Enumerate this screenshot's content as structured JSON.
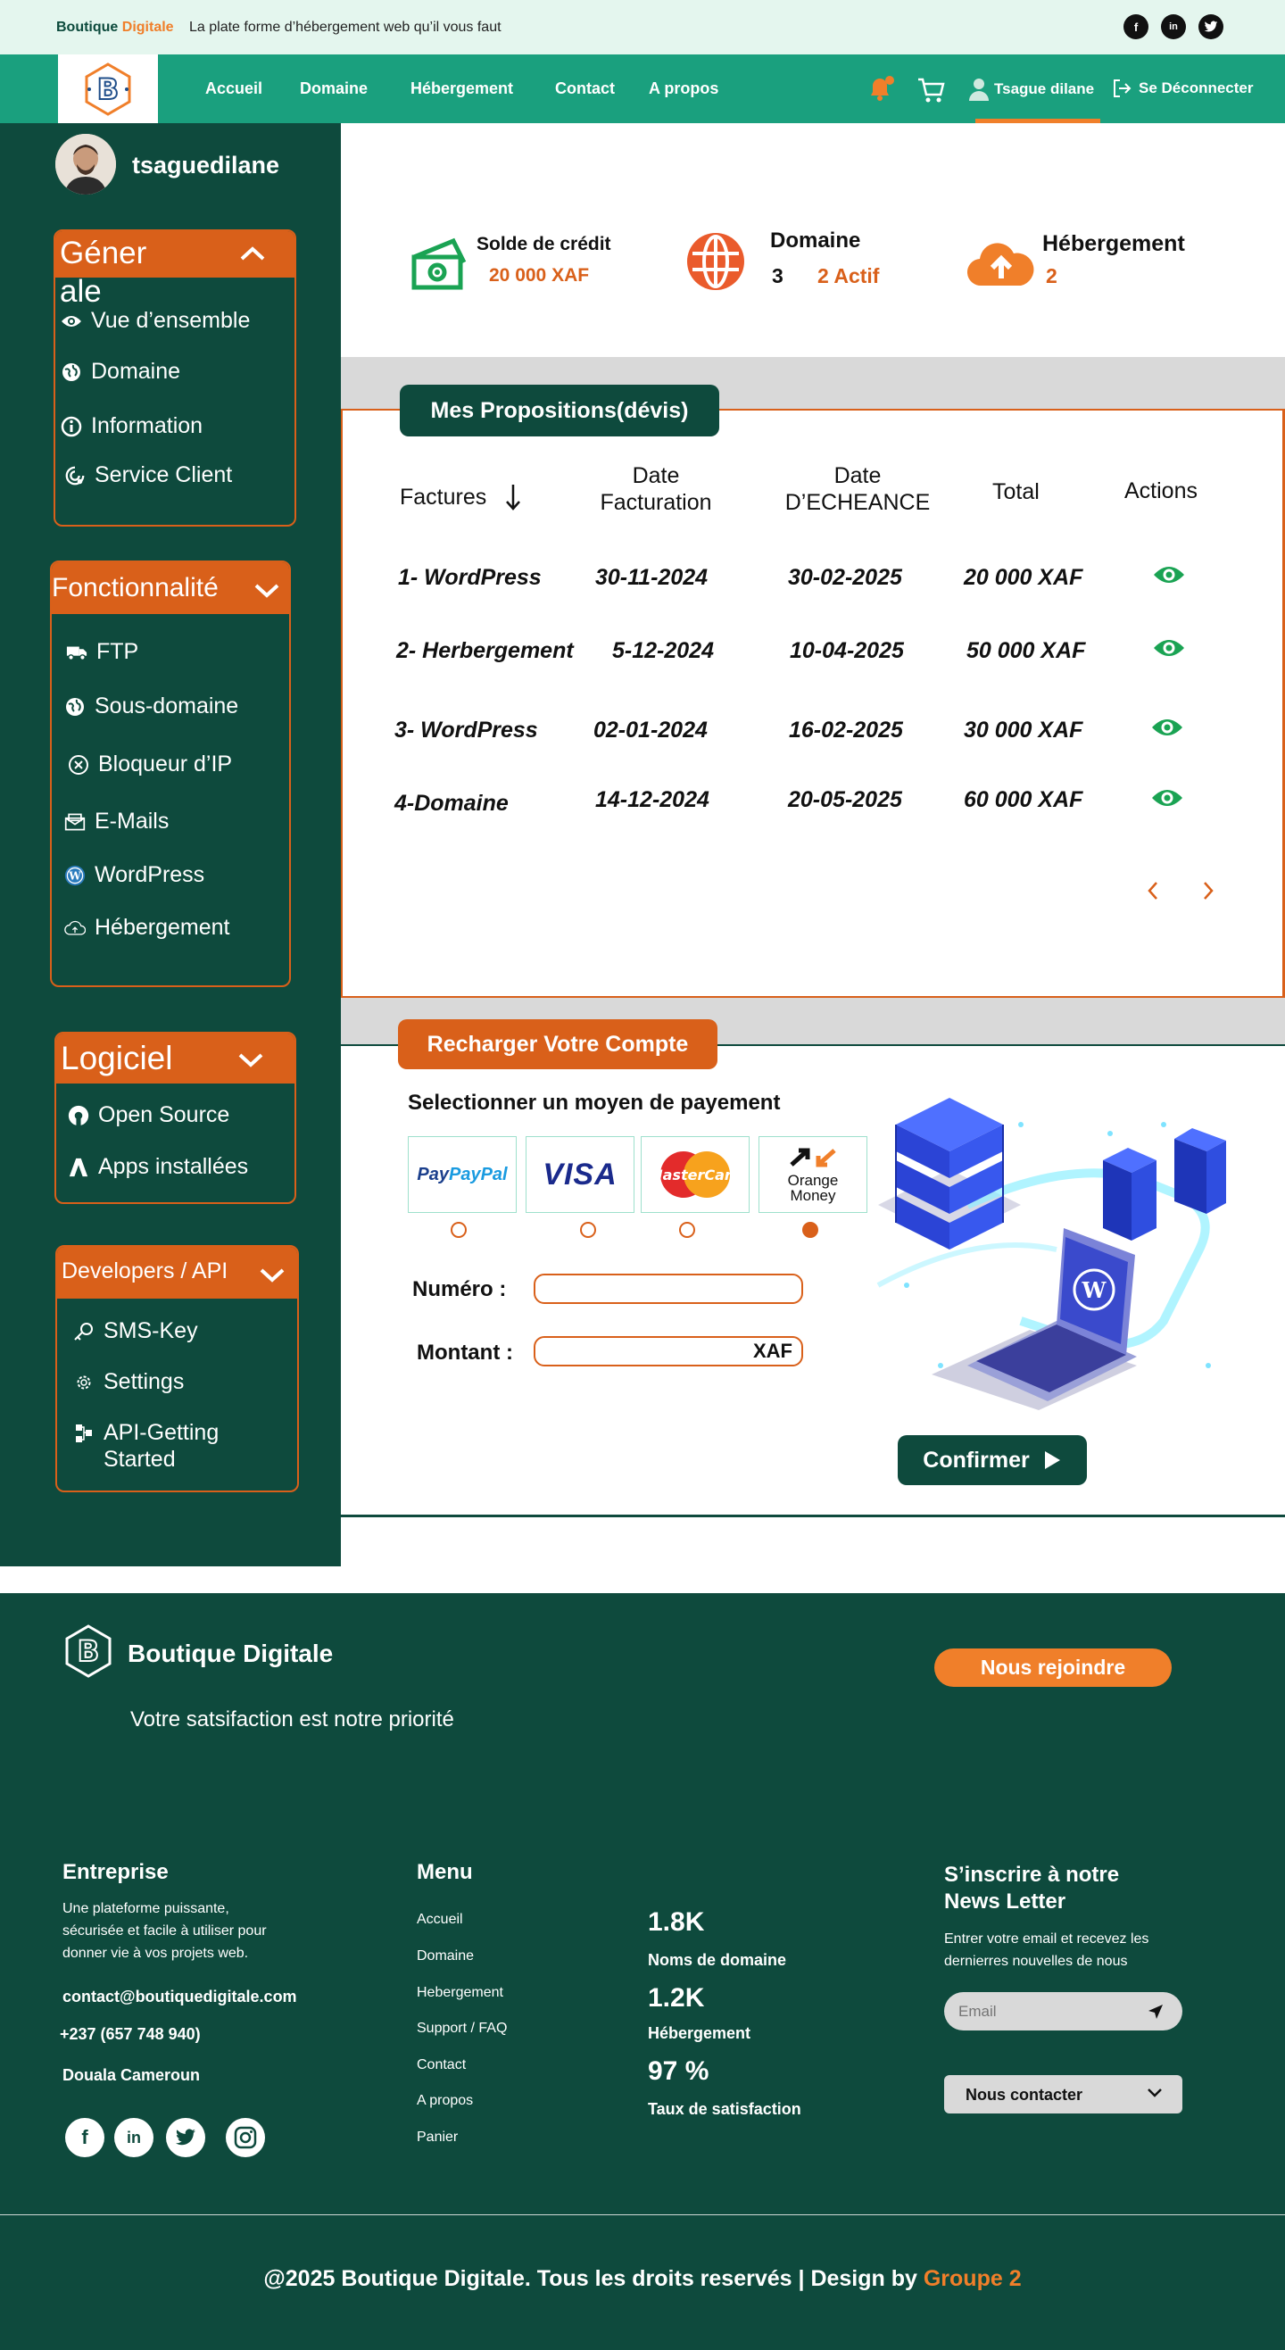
{
  "topbar": {
    "brand_main": "Boutique ",
    "brand_accent": "Digitale",
    "tagline": "La plate forme d’hébergement web qu’il vous faut",
    "social": [
      "facebook-icon",
      "linkedin-icon",
      "twitter-icon"
    ]
  },
  "nav": {
    "links": [
      "Accueil",
      "Domaine",
      "Hébergement",
      "Contact",
      "A propos"
    ],
    "user": "Tsague dilane",
    "logout": "Se Déconnecter"
  },
  "sidebar": {
    "username": "tsaguedilane",
    "general": {
      "title_line1": "Géner",
      "title_line2": "ale",
      "items": [
        "Vue d’ensemble",
        "Domaine",
        "Information",
        "Service Client"
      ]
    },
    "fonctionnalite": {
      "title": "Fonctionnalité",
      "items": [
        "FTP",
        "Sous-domaine",
        "Bloqueur d’IP",
        "E-Mails",
        "WordPress",
        "Hébergement"
      ]
    },
    "logiciel": {
      "title": "Logiciel",
      "items": [
        "Open Source",
        "Apps installées"
      ]
    },
    "developers": {
      "title": "Developers / API",
      "items": [
        "SMS-Key",
        "Settings",
        "API-Getting",
        "Started"
      ]
    }
  },
  "stats": {
    "credit_label": "Solde de crédit",
    "credit_value": "20 000 XAF",
    "domain_label": "Domaine",
    "domain_count": "3",
    "domain_active": "2 Actif",
    "hosting_label": "Hébergement",
    "hosting_value": "2"
  },
  "propositions": {
    "title": "Mes Propositions(dévis)",
    "headers": {
      "factures": "Factures",
      "date_fact_1": "Date",
      "date_fact_2": "Facturation",
      "date_ech_1": "Date",
      "date_ech_2": "D’ECHEANCE",
      "total": "Total",
      "actions": "Actions"
    },
    "rows": [
      {
        "facture": "1- WordPress",
        "date_fact": "30-11-2024",
        "date_ech": "30-02-2025",
        "total": "20 000 XAF"
      },
      {
        "facture": "2- Herbergement",
        "date_fact": "5-12-2024",
        "date_ech": "10-04-2025",
        "total": "50 000 XAF"
      },
      {
        "facture": "3- WordPress",
        "date_fact": "02-01-2024",
        "date_ech": "16-02-2025",
        "total": "30 000 XAF"
      },
      {
        "facture": "4-Domaine",
        "date_fact": "14-12-2024",
        "date_ech": "20-05-2025",
        "total": "60 000 XAF"
      }
    ]
  },
  "recharge": {
    "title": "Recharger Votre Compte",
    "subtitle": "Selectionner un moyen de payement",
    "methods": [
      "PayPal",
      "VISA",
      "MasterCard",
      "Orange",
      "Money"
    ],
    "selected_method": "Orange Money",
    "numero_label": "Numéro :",
    "montant_label": "Montant :",
    "currency": "XAF",
    "confirm": "Confirmer"
  },
  "footer": {
    "brand": "Boutique Digitale",
    "slogan": "Votre satsifaction est notre priorité",
    "join": "Nous rejoindre",
    "entreprise_title": "Entreprise",
    "entreprise_desc_1": "Une plateforme puissante,",
    "entreprise_desc_2": "sécurisée et facile à utiliser pour",
    "entreprise_desc_3": "donner vie à vos projets web.",
    "email": "contact@boutiquedigitale.com",
    "phone": "+237 (657 748 940)",
    "city": "Douala Cameroun",
    "menu_title": "Menu",
    "menu": [
      "Accueil",
      "Domaine",
      "Hebergement",
      "Support / FAQ",
      "Contact",
      "A propos",
      "Panier"
    ],
    "stats": [
      {
        "value": "1.8K",
        "label": "Noms de domaine"
      },
      {
        "value": "1.2K",
        "label": "Hébergement"
      },
      {
        "value": "97 %",
        "label": "Taux de satisfaction"
      }
    ],
    "newsletter_title_1": "S’inscrire à notre",
    "newsletter_title_2": "News Letter",
    "newsletter_desc_1": "Entrer votre email et recevez les",
    "newsletter_desc_2": "dernierres nouvelles de nous",
    "email_placeholder": "Email",
    "contact_select": "Nous contacter",
    "copyright": "@2025 Boutique Digitale. Tous les droits reservés | Design by ",
    "copyright_accent": "Groupe 2"
  },
  "colors": {
    "dark_green": "#0e4a3d",
    "nav_green": "#1aa07e",
    "orange": "#d9601a",
    "accent_orange": "#f07f2a",
    "eye_green": "#1aa353"
  }
}
